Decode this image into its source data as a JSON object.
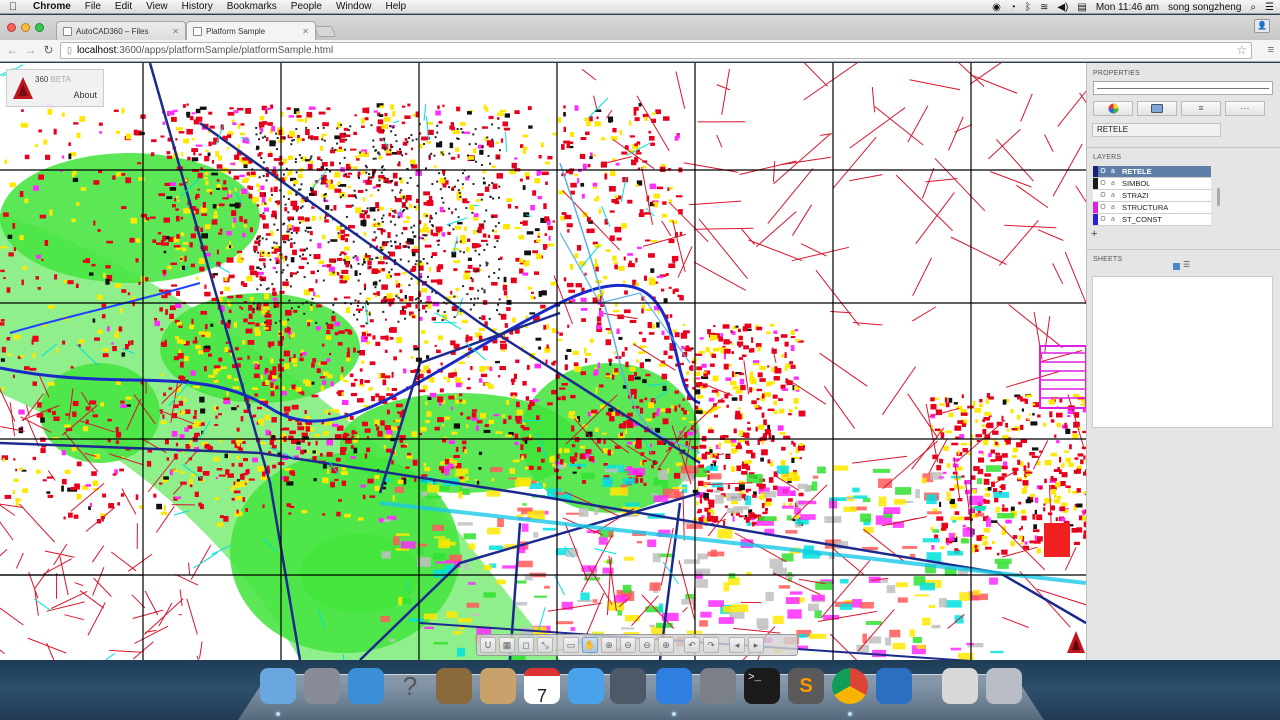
{
  "menubar": {
    "app": "Chrome",
    "menus": [
      "File",
      "Edit",
      "View",
      "History",
      "Bookmarks",
      "People",
      "Window",
      "Help"
    ],
    "clock": "Mon 11:46 am",
    "user": "song songzheng"
  },
  "browser": {
    "tabs": [
      {
        "label": "AutoCAD360 – Files",
        "active": false
      },
      {
        "label": "Platform Sample",
        "active": true
      }
    ],
    "url_host": "localhost",
    "url_path": ":3600/apps/platformSample/platformSample.html"
  },
  "app": {
    "brand": "360",
    "brand_suffix": "BETA",
    "about_label": "About"
  },
  "panel": {
    "properties_title": "PROPERTIES",
    "property_value": "RETELE",
    "layers_title": "LAYERS",
    "layers": [
      {
        "name": "RETELE",
        "color": "#1b1f7a",
        "selected": true
      },
      {
        "name": "SIMBOL",
        "color": "#1a1a1a",
        "selected": false
      },
      {
        "name": "STRAZI",
        "color": "#ffffff",
        "selected": false
      },
      {
        "name": "STRUCTURA",
        "color": "#e01ee0",
        "selected": false
      },
      {
        "name": "ST_CONST",
        "color": "#2a1fd6",
        "selected": false
      }
    ],
    "add_layer": "+",
    "sheets_title": "SHEETS"
  },
  "navbar": {
    "tools": [
      "U",
      "▦",
      "◻",
      "⤡",
      "▭",
      "✋",
      "⊕",
      "⊖",
      "⊖",
      "⊕",
      "↶",
      "↷",
      "◂",
      "▸"
    ]
  },
  "dock": {
    "apps": [
      "finder-icon",
      "launchpad-icon",
      "safari-icon",
      "help-icon",
      "preview-icon",
      "contacts-icon",
      "calendar-icon",
      "messages-icon",
      "facetime-icon",
      "app-store-icon",
      "system-preferences-icon",
      "terminal-icon",
      "sublime-text-icon",
      "chrome-icon",
      "quicktime-icon",
      "downloads-stack-icon",
      "trash-icon"
    ],
    "calendar_day": "7"
  }
}
